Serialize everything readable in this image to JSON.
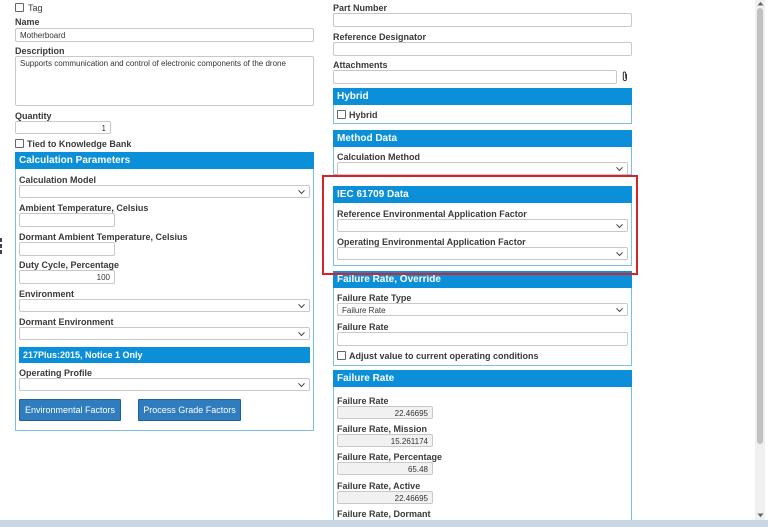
{
  "left": {
    "tag_label": "Tag",
    "name_label": "Name",
    "name_value": "Motherboard",
    "description_label": "Description",
    "description_value": "Supports communication and control of electronic components of the drone",
    "quantity_label": "Quantity",
    "quantity_value": "1",
    "tied_label": "Tied to Knowledge Bank"
  },
  "calc": {
    "title": "Calculation Parameters",
    "model_label": "Calculation Model",
    "ambient_label": "Ambient Temperature, Celsius",
    "dormant_ambient_label": "Dormant Ambient Temperature, Celsius",
    "duty_label": "Duty Cycle, Percentage",
    "duty_value": "100",
    "env_label": "Environment",
    "dormant_env_label": "Dormant Environment",
    "subheader": "217Plus:2015, Notice 1 Only",
    "op_profile_label": "Operating Profile",
    "env_factors_button": "Environmental Factors",
    "process_grade_button": "Process Grade Factors"
  },
  "right": {
    "part_number_label": "Part Number",
    "ref_des_label": "Reference Designator",
    "attachments_label": "Attachments"
  },
  "hybrid": {
    "title": "Hybrid",
    "checkbox_label": "Hybrid"
  },
  "method": {
    "title": "Method Data",
    "calc_method_label": "Calculation Method"
  },
  "iec": {
    "title": "IEC 61709 Data",
    "ref_env_label": "Reference Environmental Application Factor",
    "op_env_label": "Operating Environmental Application Factor"
  },
  "override": {
    "title": "Failure Rate, Override",
    "type_label": "Failure Rate Type",
    "type_value": "Failure Rate",
    "rate_label": "Failure Rate",
    "adjust_label": "Adjust value to current operating conditions"
  },
  "fr": {
    "title": "Failure Rate",
    "rate_label": "Failure Rate",
    "rate_value": "22.46695",
    "mission_label": "Failure Rate, Mission",
    "mission_value": "15.261174",
    "pct_label": "Failure Rate, Percentage",
    "pct_value": "65.48",
    "active_label": "Failure Rate, Active",
    "active_value": "22.46695",
    "dormant_label": "Failure Rate, Dormant"
  },
  "icons": {
    "chevron": "chevron-down-icon",
    "attach": "paperclip-icon"
  },
  "colors": {
    "panel_header": "#0a8fd8",
    "button": "#2f7dbf",
    "highlight": "#d42429"
  }
}
